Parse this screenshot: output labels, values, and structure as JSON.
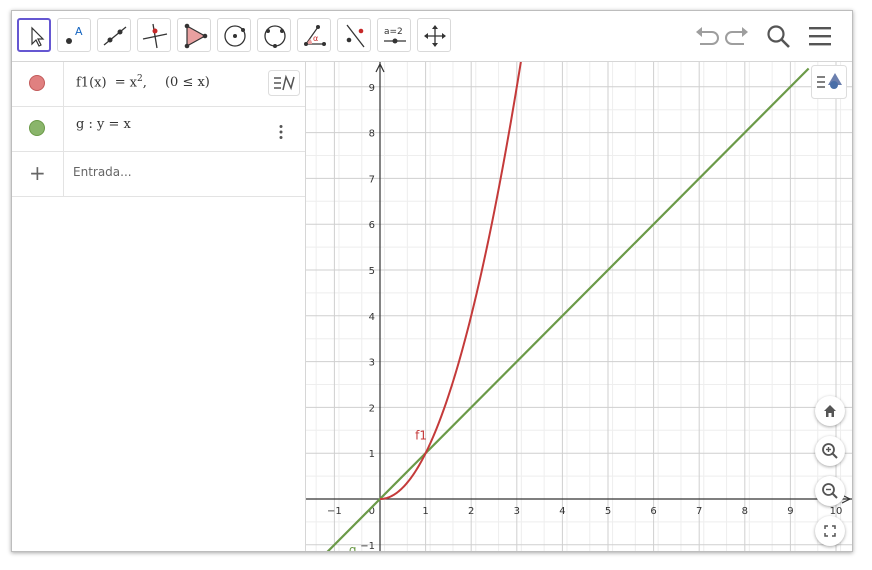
{
  "app": {
    "name": "GeoGebra"
  },
  "toolbar": {
    "tools": [
      {
        "name": "move-tool",
        "active": true
      },
      {
        "name": "point-tool",
        "glyph": "A"
      },
      {
        "name": "line-tool"
      },
      {
        "name": "perpendicular-line-tool"
      },
      {
        "name": "polygon-tool"
      },
      {
        "name": "circle-tool"
      },
      {
        "name": "circle-through-points-tool"
      },
      {
        "name": "angle-tool",
        "glyph": "α"
      },
      {
        "name": "reflect-tool"
      },
      {
        "name": "slider-tool",
        "glyph": "a=2"
      },
      {
        "name": "move-graphics-view-tool"
      }
    ],
    "right_icons": [
      "undo-icon",
      "redo-icon",
      "search-icon",
      "menu-icon"
    ]
  },
  "algebra": {
    "rows": [
      {
        "color": "#cc5c5c",
        "name": "f1",
        "lhs": "f1(x)",
        "eq": "=",
        "base": "x",
        "exp": "2",
        "sep": ",",
        "condition": "(0 ≤ x)"
      },
      {
        "color": "#6b9a48",
        "name": "g",
        "text": "g : y  =  x"
      }
    ],
    "input_placeholder": "Entrada..."
  },
  "colors": {
    "accent": "#6557d2",
    "f1": "#c43a3a",
    "g": "#6b9a48",
    "f1_dot": "#e07a7a",
    "g_dot": "#8ab56b"
  },
  "graph": {
    "curve_labels": {
      "f1": "f1",
      "g": "g"
    },
    "x_tick_labels": [
      "−1",
      "1",
      "2",
      "3",
      "4",
      "5",
      "6",
      "7",
      "8",
      "9",
      "10"
    ],
    "y_tick_labels": [
      "−1",
      "1",
      "2",
      "3",
      "4",
      "5",
      "6",
      "7",
      "8",
      "9"
    ],
    "origin_label": "0"
  },
  "chart_data": {
    "type": "line",
    "xlim": [
      -1.4,
      10.4
    ],
    "ylim": [
      -1.3,
      9.4
    ],
    "grid": true,
    "series": [
      {
        "name": "f1",
        "equation": "f1(x) = x^2, (0 ≤ x)",
        "domain": [
          0,
          3.1
        ]
      },
      {
        "name": "g",
        "equation": "y = x",
        "domain": [
          -1.4,
          9.4
        ]
      }
    ]
  }
}
